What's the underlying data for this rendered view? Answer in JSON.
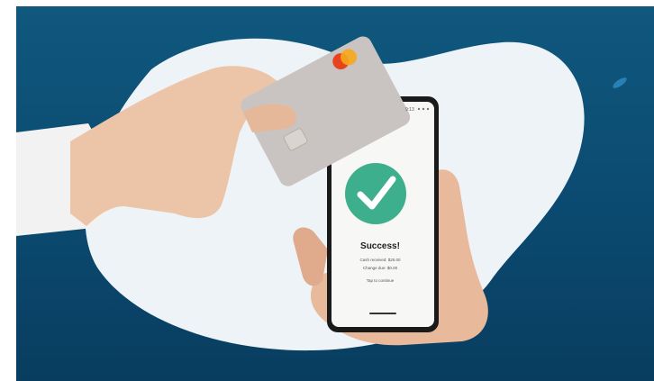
{
  "image": {
    "subject": "contactless card payment",
    "colors": {
      "background_blue": "#0b4a70",
      "blob_light": "#eef3f7",
      "card_grey": "#c9c4c1",
      "check_green": "#3eaf8c",
      "phone_black": "#1a1a1a"
    },
    "icons": [
      "payment-card",
      "mastercard-logo",
      "chip-icon",
      "check-icon",
      "smartphone"
    ]
  },
  "phone_screen": {
    "status": "9:13",
    "title": "Success!",
    "line1": "Cash received: $25.00",
    "line2": "Change due: $0.00",
    "tap_hint": "Tap to continue"
  }
}
